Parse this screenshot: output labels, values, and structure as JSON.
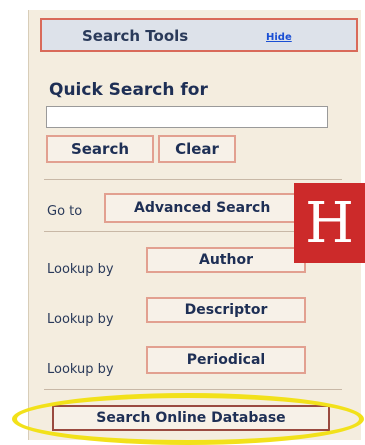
{
  "header": {
    "title": "Search Tools",
    "hide_link": "Hide"
  },
  "quick_search": {
    "label": "Quick Search for",
    "input_value": "",
    "search_label": "Search",
    "clear_label": "Clear"
  },
  "goto": {
    "label": "Go to",
    "button": "Advanced Search"
  },
  "lookups": [
    {
      "label": "Lookup by",
      "button": "Author"
    },
    {
      "label": "Lookup by",
      "button": "Descriptor"
    },
    {
      "label": "Lookup by",
      "button": "Periodical"
    }
  ],
  "online": {
    "button": "Search Online Database"
  },
  "badge": {
    "letter": "H",
    "color": "#cc2a2a"
  },
  "highlight": {
    "color": "#f2e11a"
  }
}
